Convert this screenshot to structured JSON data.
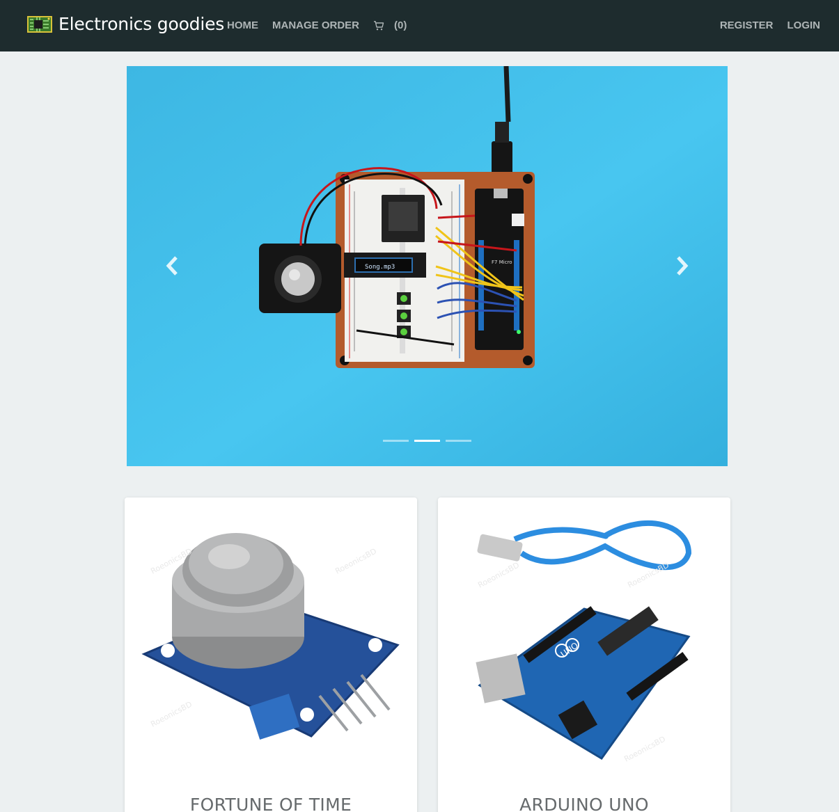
{
  "navbar": {
    "brand": "Electronics goodies",
    "logo_icon": "circuit-board-icon",
    "links_left": [
      "HOME",
      "MANAGE ORDER"
    ],
    "cart_icon": "shopping-cart-icon",
    "cart_count": "(0)",
    "links_right": [
      "REGISTER",
      "LOGIN"
    ]
  },
  "carousel": {
    "prev_icon": "chevron-left-icon",
    "next_icon": "chevron-right-icon",
    "slide_count": 3,
    "active_index": 1,
    "slide_screen_text": "Song.mp3",
    "slide_board_label": "F7 Micro"
  },
  "products": [
    {
      "title": "FORTUNE OF TIME",
      "image": "gas-sensor-module"
    },
    {
      "title": "ARDUINO UNO",
      "image": "arduino-uno-with-usb-cable"
    }
  ],
  "colors": {
    "navbar_bg": "#1e2c2e",
    "page_bg": "#ecf0f1",
    "nav_link": "#aeb5b6",
    "carousel_bg": "#3ab8e4"
  }
}
